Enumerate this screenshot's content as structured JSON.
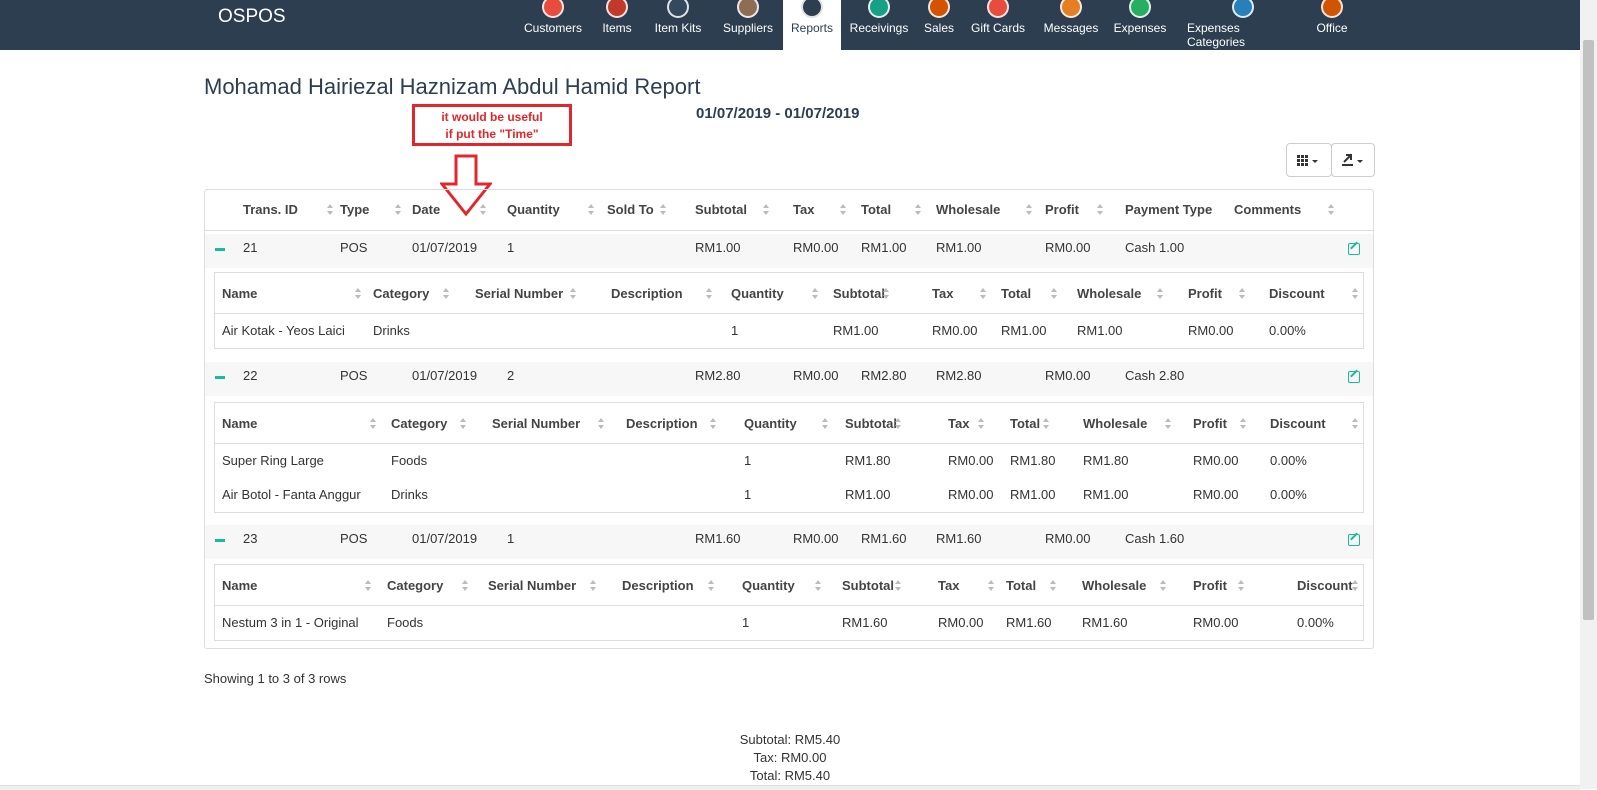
{
  "app": {
    "brand": "OSPOS"
  },
  "nav": [
    {
      "label": "Customers",
      "color": "#e74c3c",
      "icon": "customers-icon"
    },
    {
      "label": "Items",
      "color": "#c0392b",
      "icon": "items-icon"
    },
    {
      "label": "Item Kits",
      "color": "#34495e",
      "icon": "item-kits-icon"
    },
    {
      "label": "Suppliers",
      "color": "#8e6e53",
      "icon": "suppliers-icon"
    },
    {
      "label": "Reports",
      "color": "#2c3e50",
      "icon": "reports-icon",
      "active": true
    },
    {
      "label": "Receivings",
      "color": "#16a085",
      "icon": "receivings-icon"
    },
    {
      "label": "Sales",
      "color": "#d35400",
      "icon": "sales-icon"
    },
    {
      "label": "Gift Cards",
      "color": "#e74c3c",
      "icon": "gift-cards-icon"
    },
    {
      "label": "Messages",
      "color": "#e67e22",
      "icon": "messages-icon"
    },
    {
      "label": "Expenses",
      "color": "#27ae60",
      "icon": "expenses-icon"
    },
    {
      "label": "Expenses Categories",
      "color": "#2980b9",
      "icon": "expenses-categories-icon"
    },
    {
      "label": "Office",
      "color": "#d35400",
      "icon": "office-icon"
    }
  ],
  "report": {
    "title": "Mohamad Hairiezal Haznizam Abdul Hamid Report",
    "date_range": "01/07/2019 - 01/07/2019"
  },
  "annotation": {
    "line1": "it would be useful",
    "line2": "if put the \"Time\""
  },
  "main_headers": [
    "Trans. ID",
    "Type",
    "Date",
    "Quantity",
    "Sold To",
    "Subtotal",
    "Tax",
    "Total",
    "Wholesale",
    "Profit",
    "Payment Type",
    "Comments"
  ],
  "detail_headers": [
    "Name",
    "Category",
    "Serial Number",
    "Description",
    "Quantity",
    "Subtotal",
    "Tax",
    "Total",
    "Wholesale",
    "Profit",
    "Discount"
  ],
  "transactions": [
    {
      "row": [
        "21",
        "POS",
        "01/07/2019",
        "1",
        "",
        "RM1.00",
        "RM0.00",
        "RM1.00",
        "RM1.00",
        "RM0.00",
        "Cash 1.00",
        ""
      ],
      "items": [
        [
          "Air Kotak - Yeos Laici",
          "Drinks",
          "",
          "",
          "1",
          "RM1.00",
          "RM0.00",
          "RM1.00",
          "RM1.00",
          "RM0.00",
          "0.00%"
        ]
      ]
    },
    {
      "row": [
        "22",
        "POS",
        "01/07/2019",
        "2",
        "",
        "RM2.80",
        "RM0.00",
        "RM2.80",
        "RM2.80",
        "RM0.00",
        "Cash 2.80",
        ""
      ],
      "items": [
        [
          "Super Ring Large",
          "Foods",
          "",
          "",
          "1",
          "RM1.80",
          "RM0.00",
          "RM1.80",
          "RM1.80",
          "RM0.00",
          "0.00%"
        ],
        [
          "Air Botol - Fanta Anggur",
          "Drinks",
          "",
          "",
          "1",
          "RM1.00",
          "RM0.00",
          "RM1.00",
          "RM1.00",
          "RM0.00",
          "0.00%"
        ]
      ]
    },
    {
      "row": [
        "23",
        "POS",
        "01/07/2019",
        "1",
        "",
        "RM1.60",
        "RM0.00",
        "RM1.60",
        "RM1.60",
        "RM0.00",
        "Cash 1.60",
        ""
      ],
      "items": [
        [
          "Nestum 3 in 1 - Original",
          "Foods",
          "",
          "",
          "1",
          "RM1.60",
          "RM0.00",
          "RM1.60",
          "RM1.60",
          "RM0.00",
          "0.00%"
        ]
      ]
    }
  ],
  "pagination": {
    "info": "Showing 1 to 3 of 3 rows"
  },
  "summary": {
    "subtotal": "Subtotal: RM5.40",
    "tax": "Tax: RM0.00",
    "total": "Total: RM5.40"
  }
}
